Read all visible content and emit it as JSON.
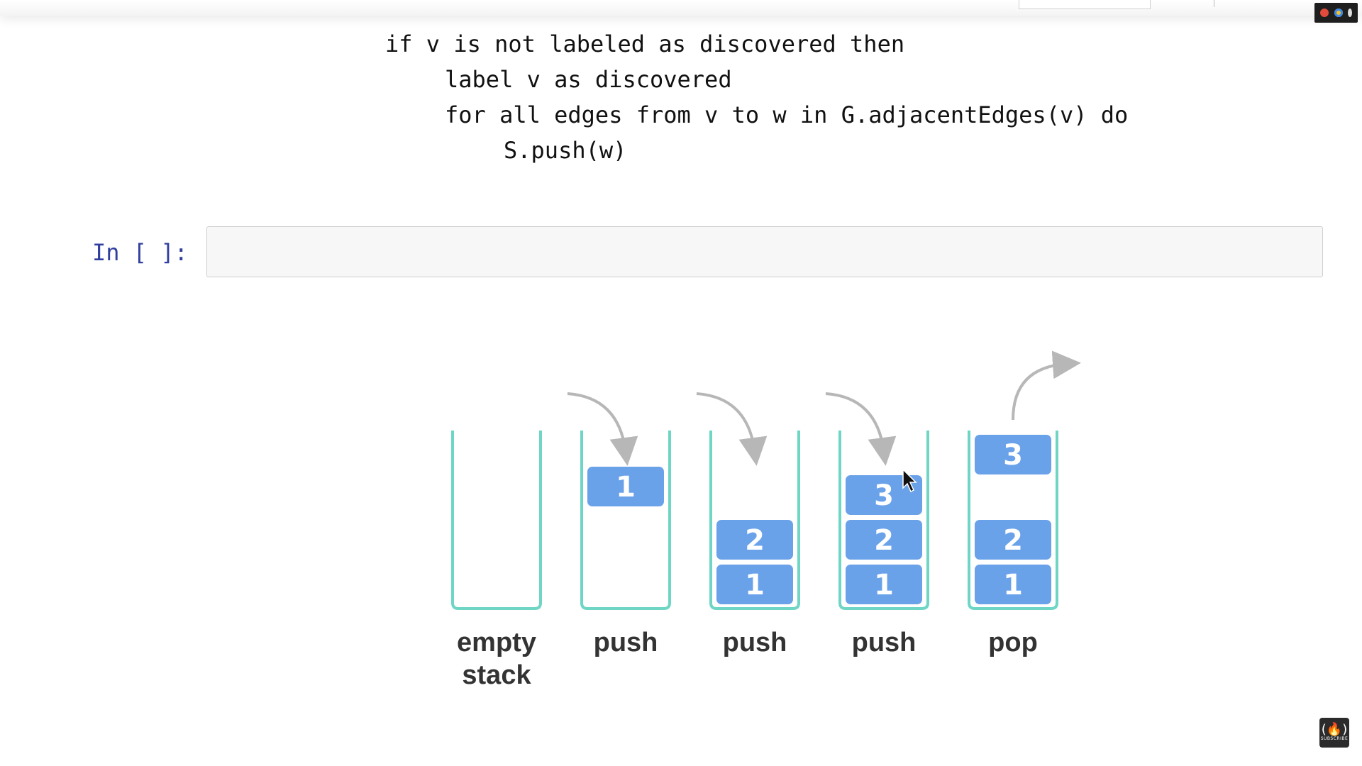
{
  "code": {
    "lines": [
      "if v is not labeled as discovered then",
      "label v as discovered",
      "for all edges from v to w in G.adjacentEdges(v) do",
      "S.push(w)"
    ]
  },
  "cell": {
    "prompt": "In [ ]:"
  },
  "diagram": {
    "stacks": [
      {
        "label_lines": [
          "empty",
          "stack"
        ],
        "items": []
      },
      {
        "label_lines": [
          "push"
        ],
        "items": [
          "1"
        ]
      },
      {
        "label_lines": [
          "push"
        ],
        "items": [
          "1",
          "2"
        ]
      },
      {
        "label_lines": [
          "push"
        ],
        "items": [
          "1",
          "2",
          "3"
        ]
      },
      {
        "label_lines": [
          "pop"
        ],
        "items": [
          "1",
          "2",
          "3"
        ]
      }
    ],
    "colors": {
      "container": "#6fd6c6",
      "box": "#6aa2ea",
      "arrow": "#b7b7b7",
      "label": "#333333"
    }
  },
  "logo": {
    "text": "SUBSCRIBE"
  }
}
